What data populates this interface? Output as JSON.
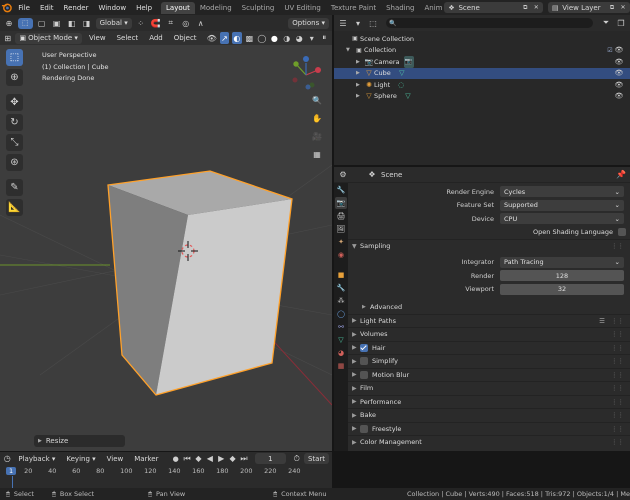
{
  "topbar": {
    "menus": [
      "File",
      "Edit",
      "Render",
      "Window",
      "Help"
    ],
    "workspaces": [
      "Layout",
      "Modeling",
      "Sculpting",
      "UV Editing",
      "Texture Paint",
      "Shading",
      "Anima"
    ],
    "active_workspace": "Layout",
    "scene": "Scene",
    "view_layer": "View Layer"
  },
  "viewport_header": {
    "transform": "Global",
    "options": "Options"
  },
  "viewport_header2": {
    "mode": "Object Mode",
    "menus": [
      "View",
      "Select",
      "Add",
      "Object"
    ]
  },
  "viewport": {
    "info": [
      "User Perspective",
      "(1) Collection | Cube",
      "Rendering Done"
    ],
    "resize_panel": "Resize",
    "gizmo": {
      "x": "X",
      "y": "Y",
      "z": "Z"
    }
  },
  "outliner": {
    "search_placeholder": "",
    "rows": [
      {
        "label": "Scene Collection",
        "indent": 0,
        "icon": "scene-collection-icon",
        "selected": false
      },
      {
        "label": "Collection",
        "indent": 1,
        "icon": "collection-icon",
        "selected": false
      },
      {
        "label": "Camera",
        "indent": 2,
        "icon": "camera-icon",
        "selected": false
      },
      {
        "label": "Cube",
        "indent": 2,
        "icon": "cube-icon",
        "selected": true
      },
      {
        "label": "Light",
        "indent": 2,
        "icon": "light-icon",
        "selected": false
      },
      {
        "label": "Sphere",
        "indent": 2,
        "icon": "sphere-icon",
        "selected": false
      }
    ]
  },
  "properties": {
    "context": "Scene",
    "render_engine_label": "Render Engine",
    "render_engine": "Cycles",
    "feature_set_label": "Feature Set",
    "feature_set": "Supported",
    "device_label": "Device",
    "device": "CPU",
    "osl_label": "Open Shading Language",
    "sampling": "Sampling",
    "integrator_label": "Integrator",
    "integrator": "Path Tracing",
    "render_label": "Render",
    "render_samples": "128",
    "viewport_label": "Viewport",
    "viewport_samples": "32",
    "advanced": "Advanced",
    "panels": [
      {
        "label": "Light Paths",
        "checkbox": null
      },
      {
        "label": "Volumes",
        "checkbox": null
      },
      {
        "label": "Hair",
        "checkbox": true
      },
      {
        "label": "Simplify",
        "checkbox": false
      },
      {
        "label": "Motion Blur",
        "checkbox": false
      },
      {
        "label": "Film",
        "checkbox": null
      },
      {
        "label": "Performance",
        "checkbox": null
      },
      {
        "label": "Bake",
        "checkbox": null
      },
      {
        "label": "Freestyle",
        "checkbox": false
      },
      {
        "label": "Color Management",
        "checkbox": null
      }
    ]
  },
  "timeline": {
    "menus": [
      "Playback",
      "Keying",
      "View",
      "Marker"
    ],
    "current_frame": "1",
    "start_label": "Start",
    "ruler": [
      "1",
      "20",
      "40",
      "60",
      "80",
      "100",
      "120",
      "140",
      "160",
      "180",
      "200",
      "220",
      "240"
    ],
    "current_frame_marker": "1"
  },
  "statusbar": {
    "select": "Select",
    "box_select": "Box Select",
    "pan_view": "Pan View",
    "context_menu": "Context Menu",
    "stats": "Collection | Cube | Verts:490 | Faces:518 | Tris:972 | Objects:1/4 | Me"
  },
  "colors": {
    "accent": "#4772b3",
    "selection_outline": "#ffa12a",
    "viewport_bg": "#3d3d3d"
  }
}
